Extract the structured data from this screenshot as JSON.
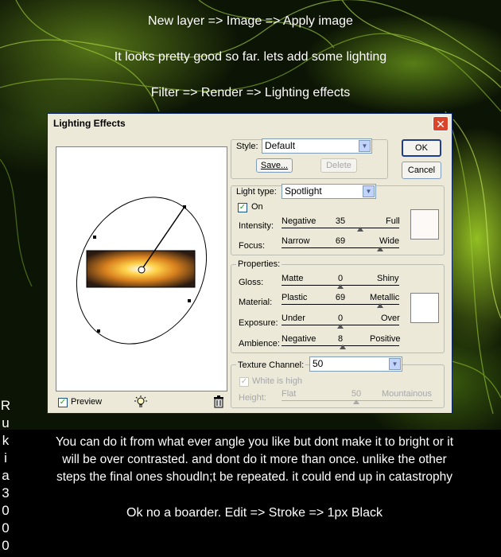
{
  "captions": {
    "line1": "New layer => Image => Apply image",
    "line2": "It looks pretty good so far. lets add some lighting",
    "line3": "Filter => Render => Lighting effects"
  },
  "side_signature": [
    "R",
    "u",
    "k",
    "i",
    "a",
    "3",
    "0",
    "0",
    "0"
  ],
  "bottom": {
    "line1": "You can do it from what ever angle you like but dont make it to bright or it",
    "line2": "will be over contrasted. and dont do it more than once. unlike the other",
    "line3": "steps the final ones shoudln;t be repeated. it could end up in catastrophy",
    "line4": "Ok  no a boarder. Edit => Stroke => 1px Black"
  },
  "dialog": {
    "title": "Lighting Effects",
    "close": "✕",
    "ok": "OK",
    "cancel": "Cancel",
    "style": {
      "label": "Style:",
      "value": "Default",
      "save": "Save...",
      "delete": "Delete"
    },
    "light_type": {
      "label": "Light type:",
      "value": "Spotlight",
      "on_label": "On",
      "on": true
    },
    "intensity": {
      "label": "Intensity:",
      "min_label": "Negative",
      "max_label": "Full",
      "value": "35",
      "min": -100,
      "max": 100
    },
    "focus": {
      "label": "Focus:",
      "min_label": "Narrow",
      "max_label": "Wide",
      "value": "69",
      "min": -100,
      "max": 100
    },
    "properties": {
      "title": "Properties:",
      "gloss": {
        "label": "Gloss:",
        "min_label": "Matte",
        "max_label": "Shiny",
        "value": "0"
      },
      "material": {
        "label": "Material:",
        "min_label": "Plastic",
        "max_label": "Metallic",
        "value": "69"
      },
      "exposure": {
        "label": "Exposure:",
        "min_label": "Under",
        "max_label": "Over",
        "value": "0"
      },
      "ambience": {
        "label": "Ambience:",
        "min_label": "Negative",
        "max_label": "Positive",
        "value": "8"
      }
    },
    "texture": {
      "label": "Texture Channel:",
      "value": "50",
      "white_is_high": "White is high",
      "height_label": "Height:",
      "min_label": "Flat",
      "max_label": "Mountainous"
    },
    "preview": {
      "label": "Preview",
      "checked": true
    }
  },
  "colors": {
    "light_swatch": "#fdf9f6",
    "properties_swatch": "#ffffff",
    "accent": "#d9442b"
  }
}
